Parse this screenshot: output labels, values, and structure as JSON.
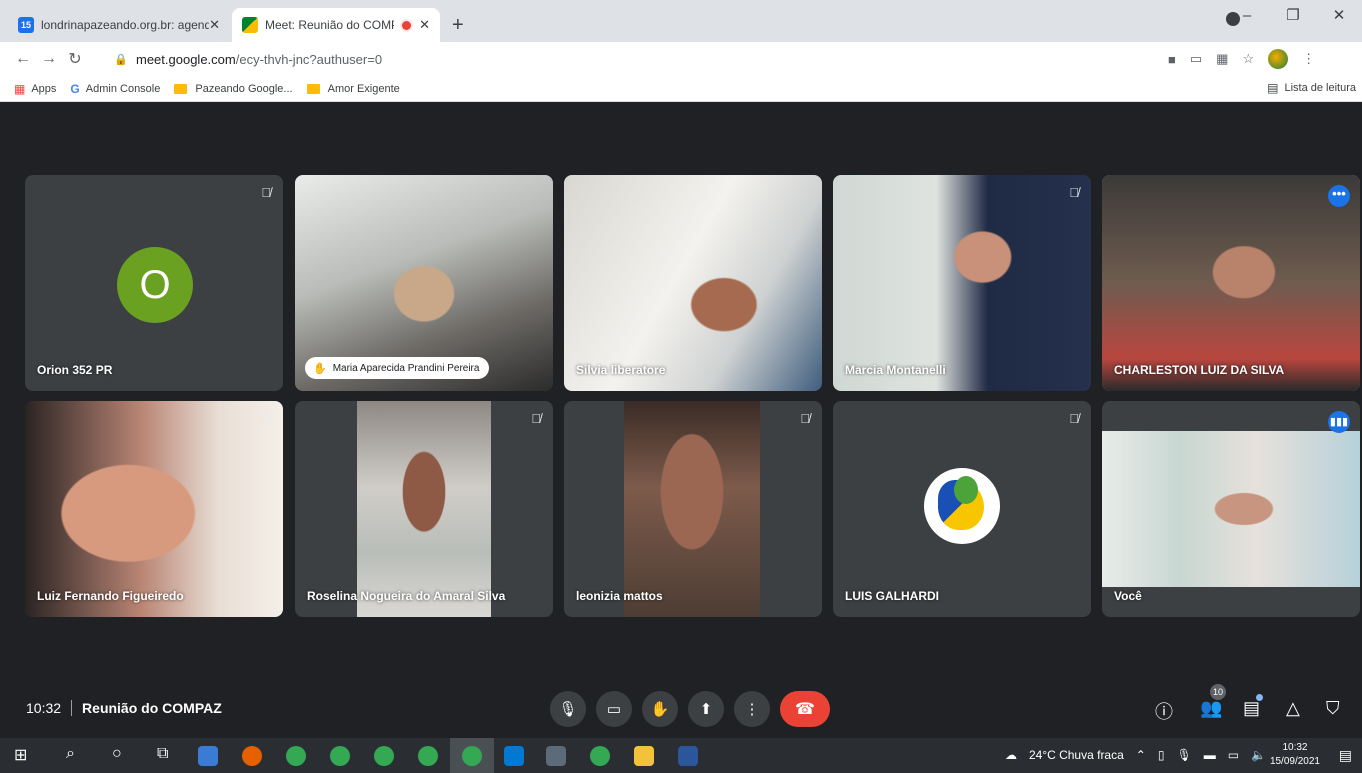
{
  "browser": {
    "tabs": [
      {
        "favicon": "15",
        "title": "londrinapazeando.org.br: agenda"
      },
      {
        "title": "Meet: Reunião do COMPAZ"
      }
    ],
    "url_host": "meet.google.com",
    "url_path": "/ecy-thvh-jnc?authuser=0",
    "bookmarks": [
      {
        "label": "Apps"
      },
      {
        "label": "Admin Console"
      },
      {
        "label": "Pazeando Google..."
      },
      {
        "label": "Amor Exigente"
      }
    ],
    "reading_list": "Lista de leitura"
  },
  "participants": [
    {
      "name": "Orion 352 PR",
      "avatar_letter": "O"
    },
    {
      "name": "Maria Aparecida Prandini Pereira"
    },
    {
      "name": "Silvia liberatore"
    },
    {
      "name": "Marcia Montanelli"
    },
    {
      "name": "CHARLESTON LUIZ DA SILVA"
    },
    {
      "name": "Luiz Fernando Figueiredo"
    },
    {
      "name": "Roselina Nogueira do Amaral Silva"
    },
    {
      "name": "leonizia mattos"
    },
    {
      "name": "LUIS GALHARDI"
    },
    {
      "name": "Você"
    }
  ],
  "meeting": {
    "time": "10:32",
    "title": "Reunião do COMPAZ",
    "participant_count": "10"
  },
  "taskbar": {
    "weather": "24°C  Chuva fraca",
    "time": "10:32",
    "date": "15/09/2021"
  },
  "colors": {
    "meet_bg": "#202124",
    "tile_bg": "#3c4043",
    "end_call": "#ea4335",
    "accent": "#1a73e8"
  }
}
